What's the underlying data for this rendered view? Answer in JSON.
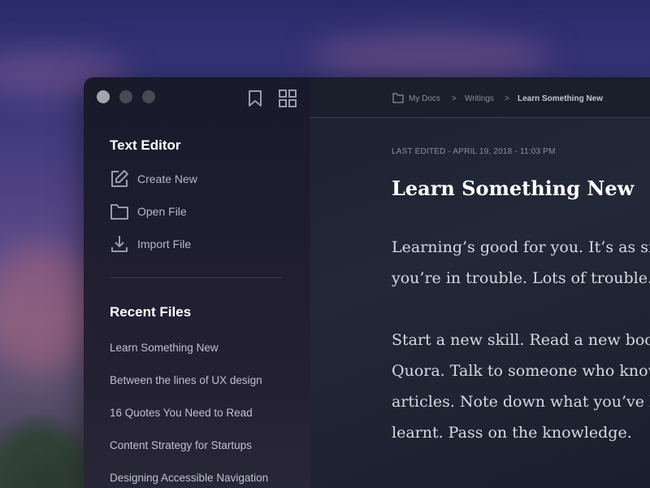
{
  "sidebar": {
    "section_title": "Text Editor",
    "actions": [
      {
        "label": "Create New",
        "icon": "edit-icon"
      },
      {
        "label": "Open File",
        "icon": "folder-icon"
      },
      {
        "label": "Import File",
        "icon": "download-icon"
      }
    ],
    "recent_title": "Recent Files",
    "recent_files": [
      "Learn Something New",
      "Between the lines of UX design",
      "16 Quotes You Need to Read",
      "Content Strategy for Startups",
      "Designing Accessible Navigation"
    ]
  },
  "breadcrumb": {
    "items": [
      "My Docs",
      "Writings",
      "Learn Something New"
    ],
    "separator": ">"
  },
  "document": {
    "meta": "LAST EDITED - APRIL 19, 2018 - 11:03 PM",
    "title": "Learn Something New",
    "lines": [
      "Learning’s good for you. It’s as sim",
      "you’re in trouble. Lots of trouble.",
      "Start a new skill. Read a new book.",
      "Quora. Talk to someone who know",
      "articles. Note down what you’ve le",
      "learnt. Pass on the knowledge."
    ]
  }
}
